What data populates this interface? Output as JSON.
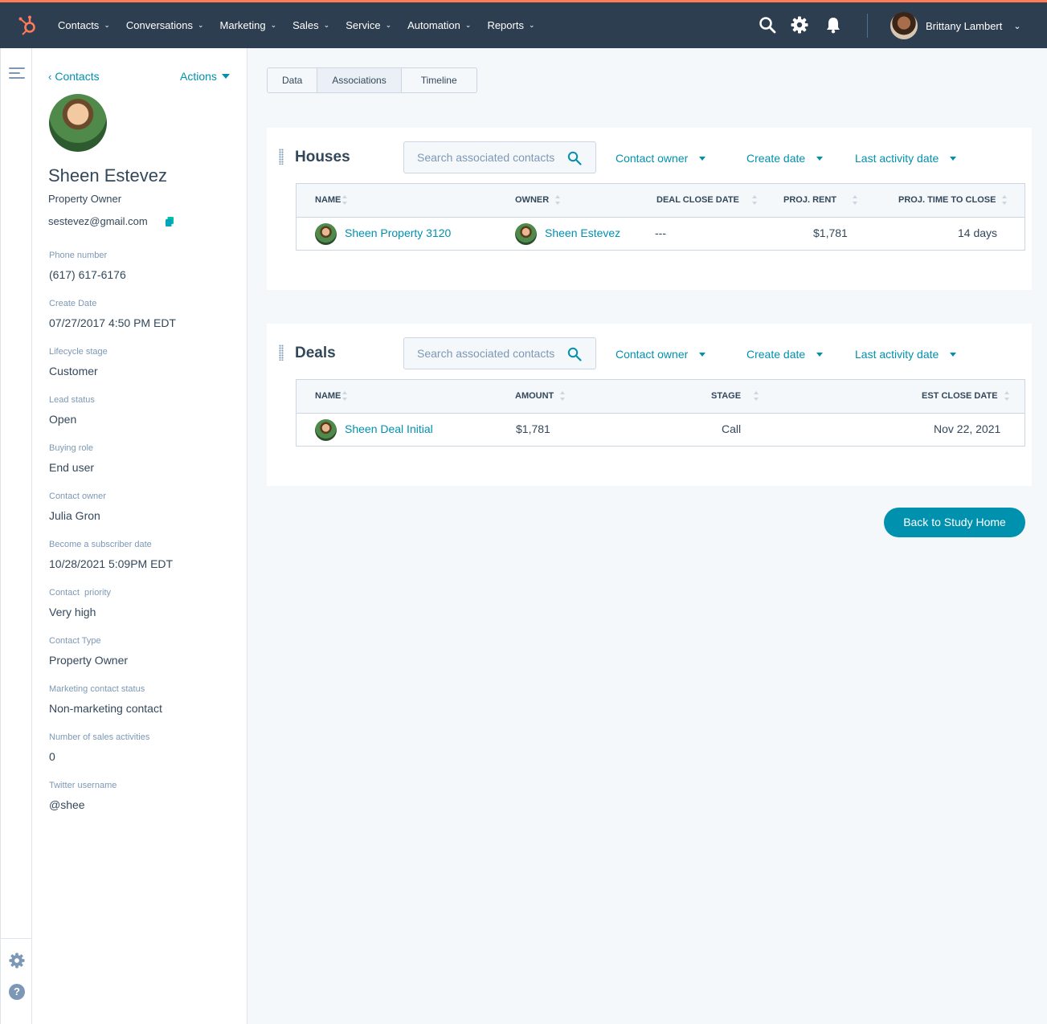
{
  "topnav": {
    "items": [
      "Contacts",
      "Conversations",
      "Marketing",
      "Sales",
      "Service",
      "Automation",
      "Reports"
    ],
    "user_name": "Brittany Lambert",
    "brand_color": "#ff7a59",
    "icons": [
      "hubspot-logo-icon",
      "search-icon",
      "gear-icon",
      "bell-icon",
      "chevron-down-icon"
    ]
  },
  "profile": {
    "back_label": "Contacts",
    "actions_label": "Actions",
    "name": "Sheen Estevez",
    "role": "Property Owner",
    "email": "sestevez@gmail.com",
    "properties": [
      {
        "label": "Phone number",
        "value": "(617) 617-6176"
      },
      {
        "label": "Create Date",
        "value": "07/27/2017 4:50 PM EDT"
      },
      {
        "label": "Lifecycle stage",
        "value": "Customer"
      },
      {
        "label": "Lead status",
        "value": "Open"
      },
      {
        "label": "Buying role",
        "value": "End user"
      },
      {
        "label": "Contact owner",
        "value": "Julia Gron"
      },
      {
        "label": "Become a subscriber date",
        "value": "10/28/2021 5:09PM EDT"
      },
      {
        "label": "Contact  priority",
        "value": "Very high"
      },
      {
        "label": "Contact Type",
        "value": "Property Owner"
      },
      {
        "label": "Marketing contact status",
        "value": "Non-marketing contact"
      },
      {
        "label": "Number of sales activities",
        "value": "0"
      },
      {
        "label": "Twitter username",
        "value": "@shee"
      }
    ]
  },
  "tabs": [
    "Data",
    "Associations",
    "Timeline"
  ],
  "active_tab": "Associations",
  "filters": {
    "search_placeholder": "Search associated contacts",
    "owner": "Contact owner",
    "create": "Create date",
    "activity": "Last activity date"
  },
  "houses": {
    "title": "Houses",
    "columns": [
      "NAME",
      "OWNER",
      "DEAL CLOSE DATE",
      "PROJ. RENT",
      "PROJ. TIME TO CLOSE"
    ],
    "rows": [
      {
        "name": "Sheen Property 3120",
        "owner": "Sheen Estevez",
        "close": "---",
        "rent": "$1,781",
        "time": "14 days"
      }
    ]
  },
  "deals": {
    "title": "Deals",
    "columns": [
      "NAME",
      "AMOUNT",
      "STAGE",
      "EST CLOSE DATE"
    ],
    "rows": [
      {
        "name": "Sheen Deal Initial",
        "amount": "$1,781",
        "stage": "Call",
        "close": "Nov 22, 2021"
      }
    ]
  },
  "back_button": "Back to Study Home",
  "accent_color": "#0091ae"
}
